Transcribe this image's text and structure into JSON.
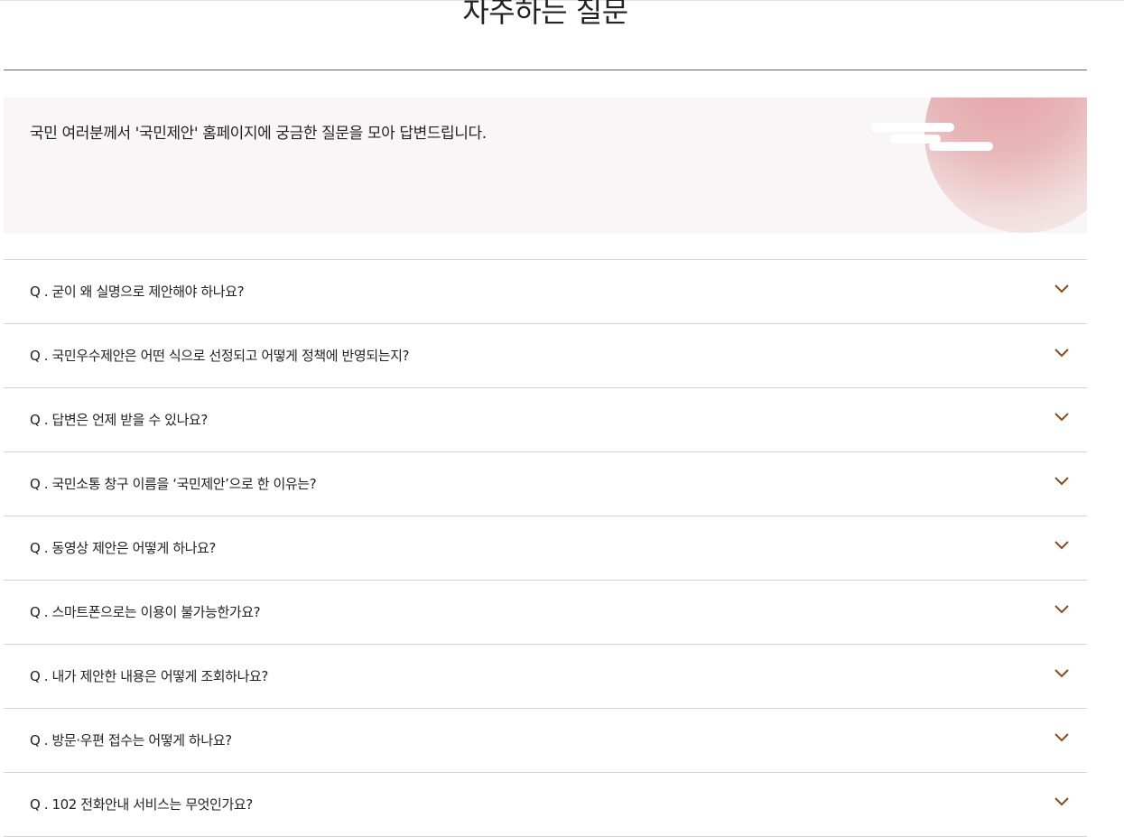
{
  "header": {
    "title": "자주하는 질문"
  },
  "intro": {
    "text": "국민 여러분께서 '국민제안' 홈페이지에 궁금한 질문을 모아 답변드립니다."
  },
  "faq": {
    "items": [
      {
        "question": "Q . 굳이 왜 실명으로 제안해야 하나요?"
      },
      {
        "question": "Q . 국민우수제안은 어떤 식으로 선정되고 어떻게 정책에 반영되는지?"
      },
      {
        "question": "Q . 답변은 언제 받을 수 있나요?"
      },
      {
        "question": "Q . 국민소통 창구 이름을 ‘국민제안’으로 한 이유는?"
      },
      {
        "question": "Q . 동영상 제안은 어떻게 하나요?"
      },
      {
        "question": "Q . 스마트폰으로는 이용이 불가능한가요?"
      },
      {
        "question": "Q . 내가 제안한 내용은 어떻게 조회하나요?"
      },
      {
        "question": "Q . 방문·우편 접수는 어떻게 하나요?"
      },
      {
        "question": "Q . 102 전화안내 서비스는 무엇인가요?"
      }
    ]
  },
  "colors": {
    "chevron": "#8a4a1a",
    "banner_bg": "#f8f6f6",
    "accent": "#e6a2a6"
  },
  "icons": {
    "expand": "chevron-down-icon"
  }
}
